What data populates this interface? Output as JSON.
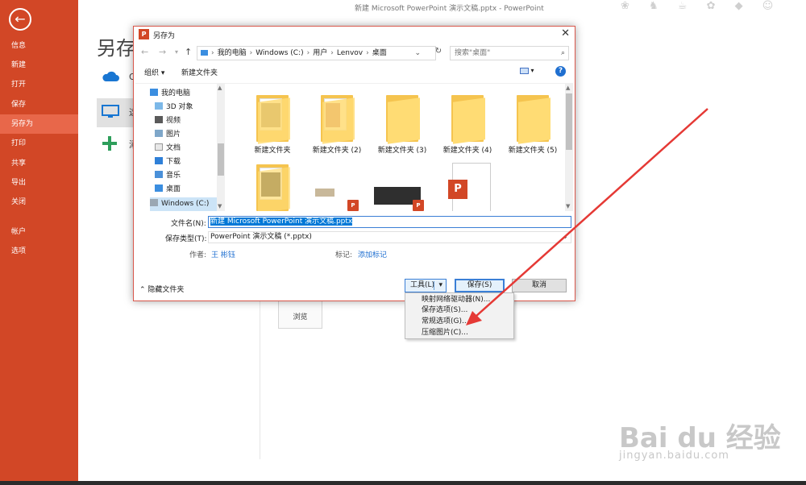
{
  "app_title": "新建 Microsoft PowerPoint 演示文稿.pptx - PowerPoint",
  "backstage": {
    "items": [
      {
        "label": "信息"
      },
      {
        "label": "新建"
      },
      {
        "label": "打开"
      },
      {
        "label": "保存"
      },
      {
        "label": "另存为",
        "active": true
      },
      {
        "label": "打印"
      },
      {
        "label": "共享"
      },
      {
        "label": "导出"
      },
      {
        "label": "关闭"
      },
      {
        "label": "帐户"
      },
      {
        "label": "选项"
      }
    ],
    "heading": "另存为",
    "places": [
      {
        "label": "O",
        "icon": "onedrive-cloud-icon"
      },
      {
        "label": "这",
        "icon": "this-pc-icon"
      },
      {
        "label": "添",
        "icon": "add-place-icon"
      }
    ],
    "browse_label": "浏览"
  },
  "dialog": {
    "title": "另存为",
    "breadcrumb": [
      "我的电脑",
      "Windows (C:)",
      "用户",
      "Lenvov",
      "桌面"
    ],
    "search_placeholder": "搜索\"桌面\"",
    "toolbar": {
      "organize": "组织 ▾",
      "new_folder": "新建文件夹"
    },
    "nav_items": [
      {
        "label": "我的电脑",
        "icon": "computer-icon"
      },
      {
        "label": "3D 对象",
        "icon": "3d-objects-icon"
      },
      {
        "label": "视频",
        "icon": "video-folder-icon"
      },
      {
        "label": "图片",
        "icon": "pictures-folder-icon"
      },
      {
        "label": "文档",
        "icon": "documents-folder-icon"
      },
      {
        "label": "下载",
        "icon": "downloads-folder-icon"
      },
      {
        "label": "音乐",
        "icon": "music-folder-icon"
      },
      {
        "label": "桌面",
        "icon": "desktop-folder-icon"
      },
      {
        "label": "Windows (C:)",
        "icon": "drive-icon",
        "selected": true
      }
    ],
    "files": [
      {
        "label": "新建文件夹"
      },
      {
        "label": "新建文件夹 (2)"
      },
      {
        "label": "新建文件夹 (3)"
      },
      {
        "label": "新建文件夹 (4)"
      },
      {
        "label": "新建文件夹 (5)"
      }
    ],
    "filename_label": "文件名(N):",
    "filename_value": "新建 Microsoft PowerPoint 演示文稿.pptx",
    "filetype_label": "保存类型(T):",
    "filetype_value": "PowerPoint 演示文稿 (*.pptx)",
    "author_label": "作者:",
    "author_value": "王 彬钰",
    "tags_label": "标记:",
    "tags_value": "添加标记",
    "hide_folders": "隐藏文件夹",
    "tools_label": "工具(L)",
    "save_label": "保存(S)",
    "cancel_label": "取消"
  },
  "tools_menu": {
    "items": [
      {
        "label": "映射网络驱动器(N)..."
      },
      {
        "label": "保存选项(S)..."
      },
      {
        "label": "常规选项(G)..."
      },
      {
        "label": "压缩图片(C)..."
      }
    ]
  },
  "watermark": {
    "brand": "Bai du 经验",
    "url": "jingyan.baidu.com"
  },
  "colors": {
    "accent": "#d24726",
    "active": "#e8674a",
    "arrow": "#e53935",
    "link": "#1f6fd0"
  }
}
